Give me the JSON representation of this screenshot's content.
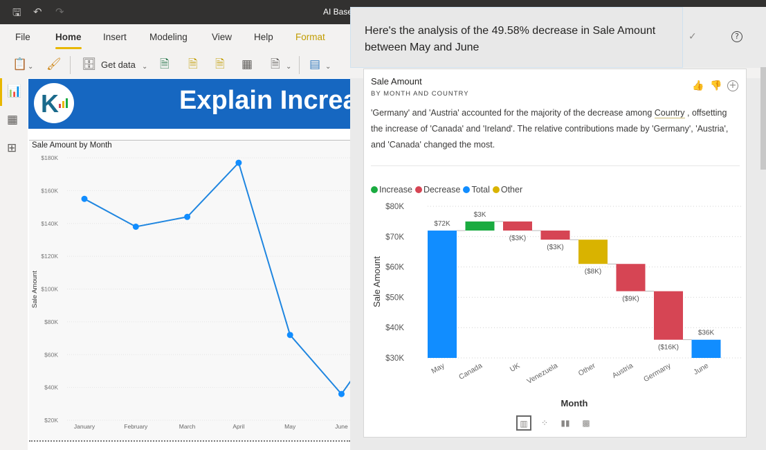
{
  "titlebar": {
    "title": "AI Base",
    "icons": [
      "save-icon",
      "undo-icon",
      "redo-icon"
    ]
  },
  "ribbon": {
    "tabs": [
      {
        "label": "File"
      },
      {
        "label": "Home",
        "active": true
      },
      {
        "label": "Insert"
      },
      {
        "label": "Modeling"
      },
      {
        "label": "View"
      },
      {
        "label": "Help"
      },
      {
        "label": "Format"
      }
    ],
    "toolbar": {
      "get_data_label": "Get data"
    }
  },
  "leftrail": {
    "items": [
      "report-view",
      "data-view",
      "model-view"
    ]
  },
  "banner": {
    "title": "Explain Increase"
  },
  "line_visual": {
    "title": "Sale Amount by Month",
    "ylabel": "Sale Amount"
  },
  "popup": {
    "header": "Here's the analysis of the 49.58% decrease in Sale Amount between May and June",
    "card": {
      "title": "Sale Amount",
      "subtitle": "BY MONTH AND COUNTRY",
      "desc_part1": "'Germany' and 'Austria' accounted for the majority of the decrease among ",
      "desc_link": "Country",
      "desc_part2": " , offsetting the increase of 'Canada' and 'Ireland'. The relative contributions made by 'Germany', 'Austria', and 'Canada' changed the most.",
      "xlabel": "Month",
      "ylabel": "Sale Amount"
    }
  },
  "colors": {
    "increase": "#1aab40",
    "decrease": "#d64554",
    "total": "#118dff",
    "other": "#d9b300",
    "accent": "#e8b700",
    "banner": "#1667c1"
  },
  "chart_data": [
    {
      "type": "line",
      "title": "Sale Amount by Month",
      "xlabel": "",
      "ylabel": "Sale Amount",
      "categories": [
        "January",
        "February",
        "March",
        "April",
        "May",
        "June"
      ],
      "values": [
        155,
        138,
        144,
        177,
        72,
        36
      ],
      "units": "$K",
      "ylim": [
        20,
        180
      ],
      "yticks": [
        "$20K",
        "$40K",
        "$60K",
        "$80K",
        "$100K",
        "$120K",
        "$140K",
        "$160K",
        "$180K"
      ],
      "grid": true
    },
    {
      "type": "bar",
      "subtype": "waterfall",
      "title": "Sale Amount",
      "xlabel": "Month",
      "ylabel": "Sale Amount",
      "categories": [
        "May",
        "Canada",
        "UK",
        "Venezuela",
        "Other",
        "Austria",
        "Germany",
        "June"
      ],
      "kinds": [
        "total",
        "increase",
        "decrease",
        "decrease",
        "other",
        "decrease",
        "decrease",
        "total"
      ],
      "values": [
        72,
        3,
        -3,
        -3,
        -8,
        -9,
        -16,
        36
      ],
      "labels": [
        "$72K",
        "$3K",
        "($3K)",
        "($3K)",
        "($8K)",
        "($9K)",
        "($16K)",
        "$36K"
      ],
      "units": "$K",
      "ylim": [
        30,
        80
      ],
      "yticks": [
        "$30K",
        "$40K",
        "$50K",
        "$60K",
        "$70K",
        "$80K"
      ],
      "legend": [
        "Increase",
        "Decrease",
        "Total",
        "Other"
      ],
      "legend_position": "top-left",
      "grid": true
    }
  ]
}
